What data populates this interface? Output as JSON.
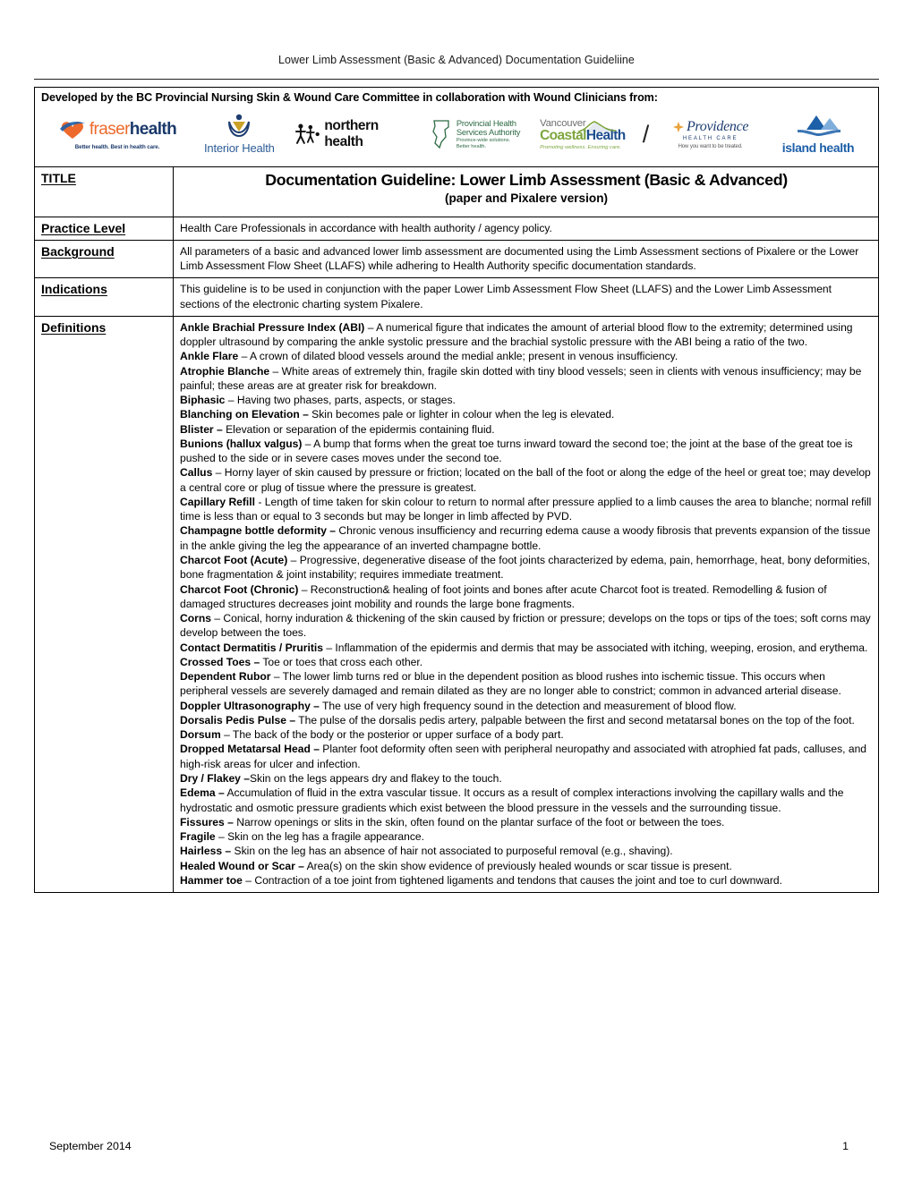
{
  "header": {
    "running_title": "Lower Limb Assessment (Basic & Advanced) Documentation Guideliine"
  },
  "banner": {
    "title": "Developed by the BC Provincial Nursing Skin & Wound Care Committee in collaboration with Wound Clinicians from:",
    "logos": [
      {
        "name": "fraser-health",
        "word_a": "fraser",
        "word_b": "health",
        "tagline": "Better health. Best in health care."
      },
      {
        "name": "interior-health",
        "word": "Interior Health"
      },
      {
        "name": "northern-health",
        "word": "northern health"
      },
      {
        "name": "provincial-health-services-authority",
        "line1": "Provincial Health",
        "line2": "Services Authority",
        "tag1": "Province-wide solutions.",
        "tag2": "Better health."
      },
      {
        "name": "vancouver-coastal-health",
        "line1": "Vancouver",
        "word_c": "Coastal",
        "word_h": "Health",
        "tagline": "Promoting wellness. Ensuring care."
      },
      {
        "name": "separator-slash",
        "glyph": "/"
      },
      {
        "name": "providence-health-care",
        "line1": "Providence",
        "line2": "HEALTH CARE",
        "tagline": "How you want to be treated."
      },
      {
        "name": "island-health",
        "word": "island health"
      }
    ]
  },
  "table": {
    "rows": [
      {
        "label": "TITLE",
        "type": "title",
        "title_main": "Documentation Guideline: Lower Limb Assessment (Basic & Advanced)",
        "title_sub": "(paper and Pixalere version)"
      },
      {
        "label": "Practice Level",
        "type": "paragraph",
        "text": "Health Care Professionals in accordance with health authority / agency policy."
      },
      {
        "label": "Background",
        "type": "paragraph",
        "text": "All parameters of a basic and advanced lower limb assessment are documented using the Limb Assessment sections of Pixalere or the Lower Limb Assessment Flow Sheet (LLAFS) while adhering to Health Authority specific documentation standards."
      },
      {
        "label": "Indications",
        "type": "paragraph",
        "text": "This guideline is to be used in conjunction with the paper Lower Limb Assessment Flow Sheet (LLAFS) and the Lower Limb Assessment sections of the electronic charting system Pixalere."
      },
      {
        "label": "Definitions",
        "type": "definitions",
        "items": [
          {
            "term": "Ankle Brachial Pressure Index (ABI)",
            "def": " – A numerical figure that indicates the amount of arterial blood flow to the extremity; determined using doppler ultrasound by comparing the ankle systolic pressure and the brachial systolic pressure with the ABI being a ratio of the two."
          },
          {
            "term": "Ankle Flare",
            "def": " – A crown of dilated blood vessels around the medial ankle; present in venous insufficiency."
          },
          {
            "term": "Atrophie Blanche",
            "def": " – White areas of extremely thin, fragile skin dotted with tiny blood vessels; seen in clients with venous insufficiency; may be painful; these areas are at greater risk for breakdown."
          },
          {
            "term": "Biphasic",
            "def": " – Having two phases, parts, aspects, or stages."
          },
          {
            "term": "Blanching on Elevation –",
            "def": " Skin becomes pale or lighter in colour when the leg is elevated."
          },
          {
            "term": "Blister –",
            "def": " Elevation or separation of the epidermis containing fluid."
          },
          {
            "term": "Bunions (hallux valgus)",
            "def": " – A bump that forms when the great toe turns inward toward the second toe; the joint at the base of the great toe is pushed to the side or in severe cases moves under the second toe."
          },
          {
            "term": "Callus",
            "def": " – Horny layer of skin caused by pressure or friction; located on the ball of the foot or along the edge of the heel or great toe; may develop a central core or plug of tissue where the pressure is greatest."
          },
          {
            "term": "Capillary Refill",
            "def": " - Length of time taken for skin colour to return to normal after pressure applied to a limb causes the area to blanche; normal refill time is less than or equal to 3 seconds but may be longer in limb affected by PVD."
          },
          {
            "term": "Champagne bottle deformity –",
            "def": " Chronic venous insufficiency and recurring edema cause a woody fibrosis that prevents expansion of the tissue in the ankle giving the leg the appearance of an inverted champagne bottle."
          },
          {
            "term": "Charcot Foot (Acute)",
            "def": " – Progressive, degenerative disease of the foot joints characterized by edema, pain, hemorrhage, heat, bony deformities, bone fragmentation & joint instability; requires immediate treatment."
          },
          {
            "term": "Charcot Foot (Chronic)",
            "def": " – Reconstruction& healing of foot joints and bones after acute Charcot foot is treated. Remodelling & fusion of damaged structures decreases joint mobility and rounds the large bone fragments."
          },
          {
            "term": "Corns",
            "def": " – Conical, horny induration & thickening of the skin caused by friction or pressure; develops on the tops or tips of the toes; soft corns may develop between the toes."
          },
          {
            "term": "Contact Dermatitis / Pruritis",
            "def": " – Inflammation of the epidermis and dermis that may be associated with itching, weeping, erosion, and erythema."
          },
          {
            "term": "Crossed Toes –",
            "def": " Toe or toes that cross each other."
          },
          {
            "term": "Dependent Rubor",
            "def": " – The lower limb turns red or blue in the dependent position as blood rushes into ischemic tissue. This occurs when peripheral vessels are severely damaged and remain dilated as they are no longer able to constrict; common in advanced arterial disease."
          },
          {
            "term": "Doppler Ultrasonography –",
            "def": " The use of very high frequency sound in the detection and measurement of blood flow."
          },
          {
            "term": "Dorsalis Pedis Pulse –",
            "def": " The pulse of the dorsalis pedis artery, palpable between the first and second metatarsal bones on the top of the foot."
          },
          {
            "term": "Dorsum",
            "def": " – The back of the body or the posterior or upper surface of a body part."
          },
          {
            "term": "Dropped Metatarsal Head –",
            "def": " Planter foot deformity often seen with peripheral neuropathy and associated with atrophied fat pads, calluses, and high-risk areas for ulcer and infection."
          },
          {
            "term": "Dry / Flakey –",
            "def": "Skin on the legs appears dry and flakey to the touch."
          },
          {
            "term": "Edema –",
            "def": " Accumulation of fluid in the extra vascular tissue. It occurs as a result of complex interactions involving the capillary walls and the hydrostatic and osmotic pressure gradients which exist between the blood pressure in the vessels and the surrounding tissue."
          },
          {
            "term": "Fissures –",
            "def": " Narrow openings or slits in the skin, often found on the plantar surface of the foot or between the toes."
          },
          {
            "term": "Fragile",
            "def": " – Skin on the leg has a fragile appearance."
          },
          {
            "term": "Hairless –",
            "def": " Skin on the leg has an absence of hair not associated to purposeful removal (e.g., shaving)."
          },
          {
            "term": "Healed Wound or Scar –",
            "def": " Area(s) on the skin show evidence of previously healed wounds or scar tissue is present."
          },
          {
            "term": "Hammer toe",
            "def": " – Contraction of a toe joint from tightened ligaments and tendons that causes the joint and toe to curl downward."
          }
        ]
      }
    ]
  },
  "footer": {
    "date": "September 2014",
    "page_number": "1"
  }
}
